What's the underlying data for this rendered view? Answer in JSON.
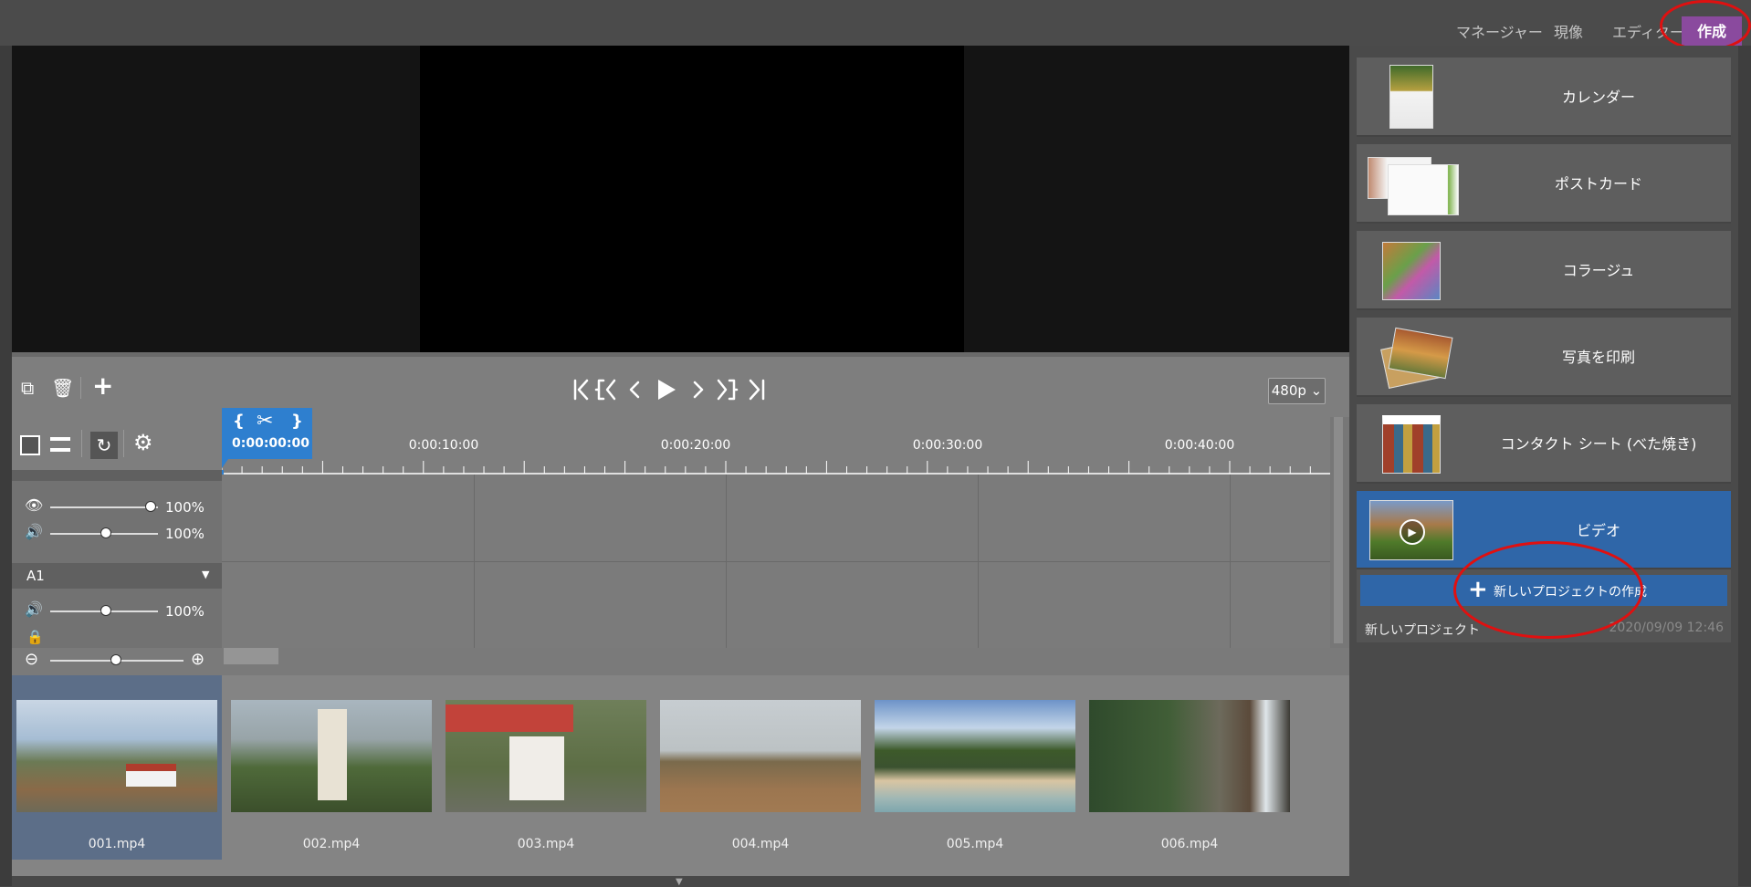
{
  "nav": {
    "manager": "マネージャー",
    "develop": "現像",
    "editor": "エディター",
    "create": "作成"
  },
  "controls": {
    "resolution": "480p"
  },
  "timeline": {
    "playhead_time": "0:00:00:00",
    "marks": [
      "0:00:10:00",
      "0:00:20:00",
      "0:00:30:00",
      "0:00:40:00"
    ],
    "video_opacity": "100%",
    "video_volume": "100%",
    "audio_track": "A1",
    "audio_volume": "100%"
  },
  "clips": [
    "001.mp4",
    "002.mp4",
    "003.mp4",
    "004.mp4",
    "005.mp4",
    "006.mp4"
  ],
  "create_panel": {
    "items": [
      "カレンダー",
      "ポストカード",
      "コラージュ",
      "写真を印刷",
      "コンタクト シート (べた焼き)",
      "ビデオ"
    ],
    "new_project_button": "新しいプロジェクトの作成",
    "project_name": "新しいプロジェクト",
    "project_date": "2020/09/09 12:46"
  },
  "colors": {
    "accent": "#2e7fcf",
    "create_tab": "#8a4a9e",
    "selected_card": "#2f66a8",
    "annotation": "#e01010"
  }
}
